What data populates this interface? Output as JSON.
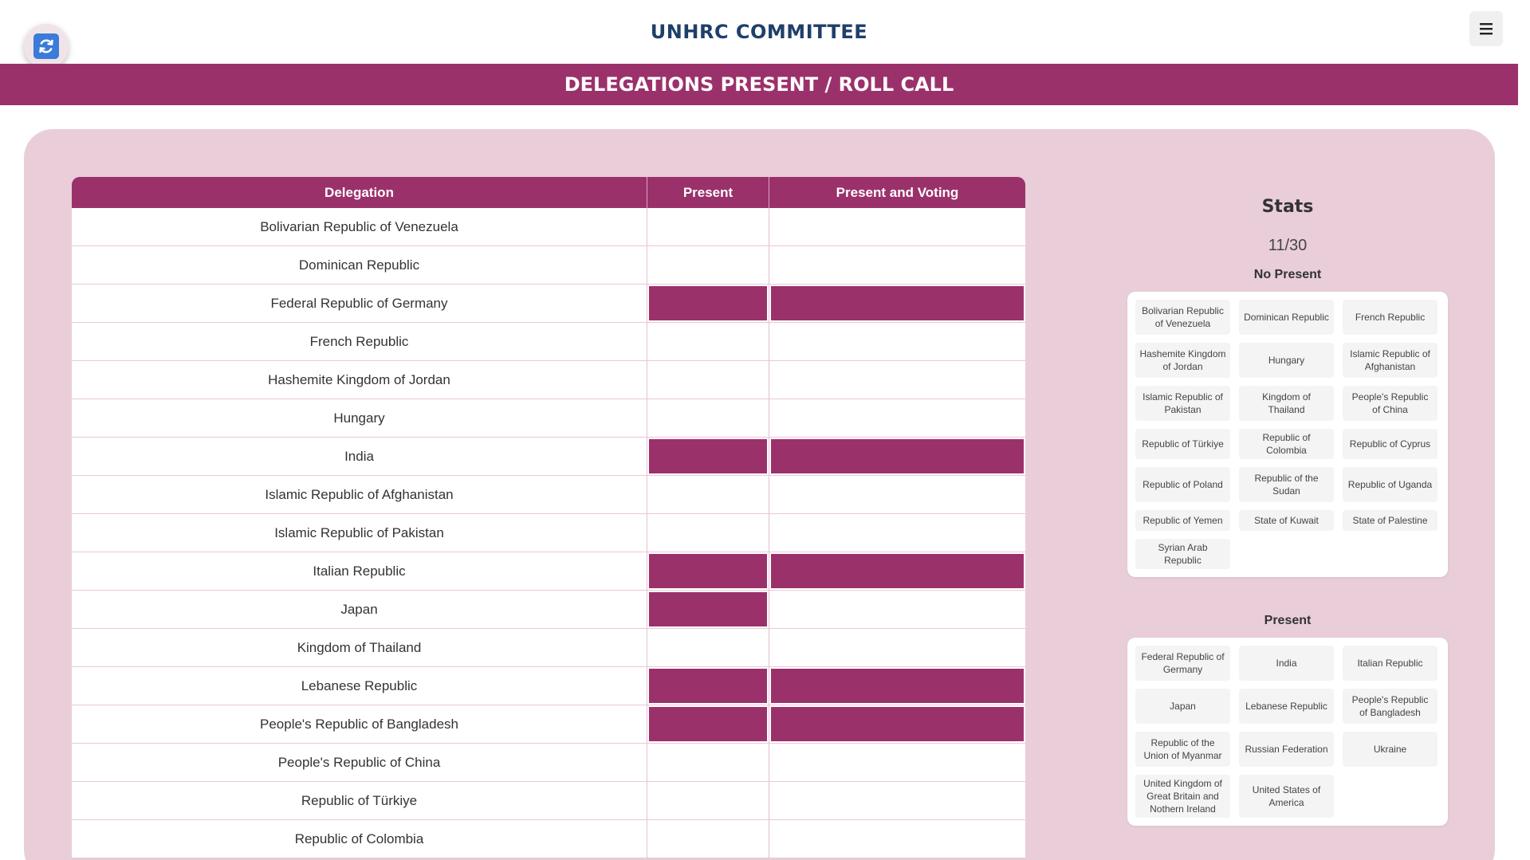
{
  "header": {
    "title": "UNHRC COMMITTEE"
  },
  "banner": {
    "title": "DELEGATIONS PRESENT / ROLL CALL"
  },
  "icons": {
    "refresh": "refresh-icon",
    "menu": "hamburger-menu-icon"
  },
  "colors": {
    "accent": "#9b316b",
    "panel": "#e9ced9",
    "title": "#1f3f6b",
    "refresh": "#3b7bd9"
  },
  "table": {
    "columns": [
      "Delegation",
      "Present",
      "Present and Voting"
    ],
    "rows": [
      {
        "name": "Bolivarian Republic of Venezuela",
        "present": false,
        "voting": false
      },
      {
        "name": "Dominican Republic",
        "present": false,
        "voting": false
      },
      {
        "name": "Federal Republic of Germany",
        "present": true,
        "voting": true
      },
      {
        "name": "French Republic",
        "present": false,
        "voting": false
      },
      {
        "name": "Hashemite Kingdom of Jordan",
        "present": false,
        "voting": false
      },
      {
        "name": "Hungary",
        "present": false,
        "voting": false
      },
      {
        "name": "India",
        "present": true,
        "voting": true
      },
      {
        "name": "Islamic Republic of Afghanistan",
        "present": false,
        "voting": false
      },
      {
        "name": "Islamic Republic of Pakistan",
        "present": false,
        "voting": false
      },
      {
        "name": "Italian Republic",
        "present": true,
        "voting": true
      },
      {
        "name": "Japan",
        "present": true,
        "voting": false
      },
      {
        "name": "Kingdom of Thailand",
        "present": false,
        "voting": false
      },
      {
        "name": "Lebanese Republic",
        "present": true,
        "voting": true
      },
      {
        "name": "People's Republic of Bangladesh",
        "present": true,
        "voting": true
      },
      {
        "name": "People's Republic of China",
        "present": false,
        "voting": false
      },
      {
        "name": "Republic of Türkiye",
        "present": false,
        "voting": false
      },
      {
        "name": "Republic of Colombia",
        "present": false,
        "voting": false
      }
    ]
  },
  "stats": {
    "title": "Stats",
    "count": "11/30",
    "not_present": {
      "title": "No Present",
      "items": [
        "Bolivarian Republic of Venezuela",
        "Dominican Republic",
        "French Republic",
        "Hashemite Kingdom of Jordan",
        "Hungary",
        "Islamic Republic of Afghanistan",
        "Islamic Republic of Pakistan",
        "Kingdom of Thailand",
        "People's Republic of China",
        "Republic of Türkiye",
        "Republic of Colombia",
        "Republic of Cyprus",
        "Republic of Poland",
        "Republic of the Sudan",
        "Republic of Uganda",
        "Republic of Yemen",
        "State of Kuwait",
        "State of Palestine",
        "Syrian Arab Republic"
      ]
    },
    "present": {
      "title": "Present",
      "items": [
        "Federal Republic of Germany",
        "India",
        "Italian Republic",
        "Japan",
        "Lebanese Republic",
        "People's Republic of Bangladesh",
        "Republic of the Union of Myanmar",
        "Russian Federation",
        "Ukraine",
        "United Kingdom of Great Britain and Nothern Ireland",
        "United States of America"
      ]
    }
  }
}
